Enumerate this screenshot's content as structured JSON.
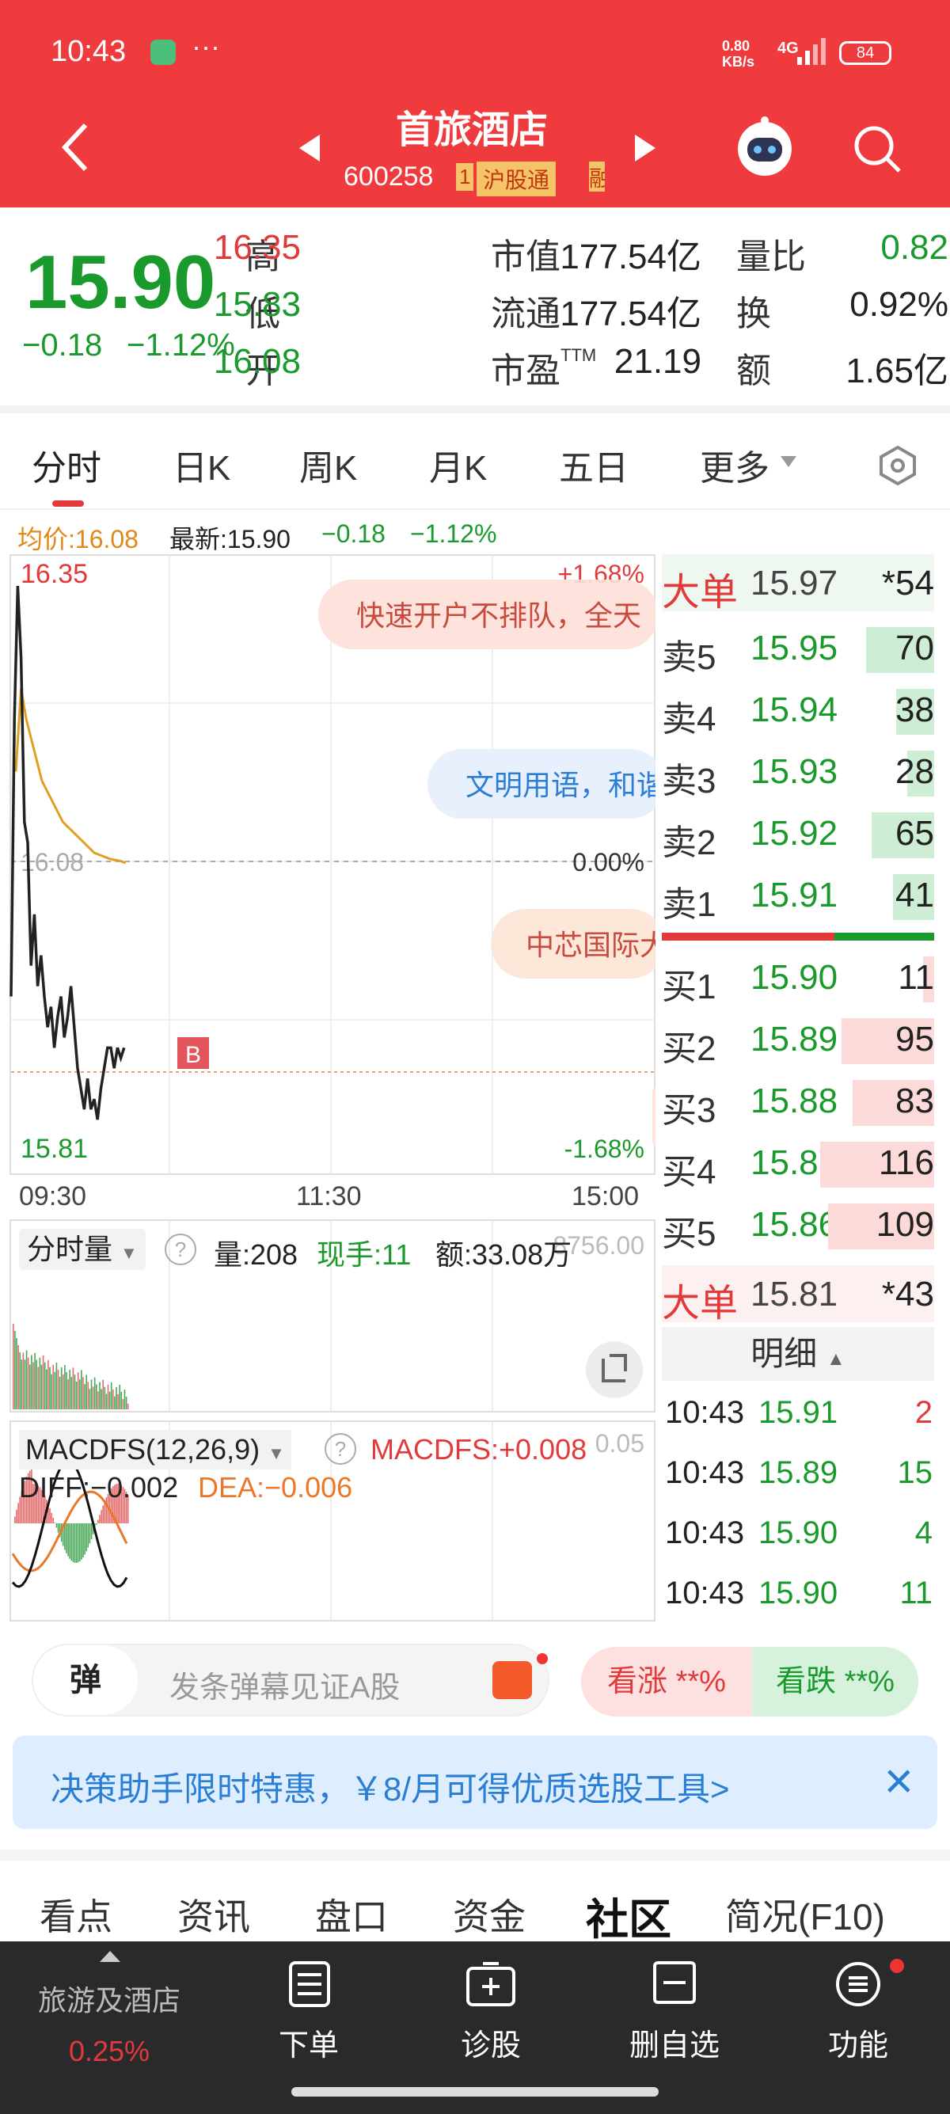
{
  "status_bar": {
    "time": "10:43",
    "dots": "···",
    "net": "0.80\nKB/s",
    "net_l1": "0.80",
    "net_l2": "KB/s",
    "signal": "4G",
    "battery": "84"
  },
  "header": {
    "title": "首旅酒店",
    "code": "600258",
    "tag1": "1",
    "tag2": "沪股通",
    "tag3": "融"
  },
  "quote": {
    "price": "15.90",
    "change": "−0.18",
    "pct": "−1.12%",
    "c1": [
      {
        "l": "高",
        "v": "16.35"
      },
      {
        "l": "低",
        "v": "15.83"
      },
      {
        "l": "开",
        "v": "16.08"
      }
    ],
    "c2": [
      {
        "l": "市值",
        "v": "177.54亿"
      },
      {
        "l": "流通",
        "v": "177.54亿"
      },
      {
        "l": "市盈",
        "sup": "TTM",
        "v": "21.19"
      }
    ],
    "c3": [
      {
        "l": "量比",
        "v": "0.82"
      },
      {
        "l": "换",
        "v": "0.92%"
      },
      {
        "l": "额",
        "v": "1.65亿"
      }
    ]
  },
  "tabs": [
    "分时",
    "日K",
    "周K",
    "月K",
    "五日",
    "更多"
  ],
  "info": {
    "avg": "均价:16.08",
    "latest": "最新:15.90",
    "chg": "−0.18",
    "pct": "−1.12%"
  },
  "chart_data": {
    "type": "line",
    "high": "16.35",
    "low": "15.81",
    "pre": "16.08",
    "pct_hi": "+1.68%",
    "pct_zero": "0.00%",
    "pct_lo": "-1.68%",
    "x_ticks": [
      "09:30",
      "11:30",
      "15:00"
    ],
    "price": [
      15.95,
      16.22,
      16.35,
      16.28,
      16.12,
      16.1,
      15.98,
      16.03,
      15.96,
      15.99,
      15.95,
      15.92,
      15.94,
      15.9,
      15.93,
      15.95,
      15.91,
      15.93,
      15.96,
      15.92,
      15.88,
      15.86,
      15.84,
      15.87,
      15.84,
      15.85,
      15.83,
      15.86,
      15.88,
      15.9,
      15.9,
      15.88,
      15.9,
      15.89,
      15.9
    ],
    "avg": [
      16.2,
      16.25,
      16.22,
      16.2,
      16.18,
      16.16,
      16.15,
      16.14,
      16.13,
      16.12,
      16.115,
      16.11,
      16.105,
      16.1,
      16.095,
      16.09,
      16.088,
      16.086,
      16.084,
      16.083,
      16.082,
      16.08
    ],
    "marker": "B"
  },
  "bubbles": [
    "快速开户不排队，全天",
    "文明用语，和谐",
    "中芯国际大"
  ],
  "orderbook": {
    "big_top": {
      "l": "大单",
      "p": "15.97",
      "v": "*54"
    },
    "sells": [
      {
        "l": "卖5",
        "p": "15.95",
        "v": "70",
        "w": 0.25
      },
      {
        "l": "卖4",
        "p": "15.94",
        "v": "38",
        "w": 0.14
      },
      {
        "l": "卖3",
        "p": "15.93",
        "v": "28",
        "w": 0.1
      },
      {
        "l": "卖2",
        "p": "15.92",
        "v": "65",
        "w": 0.23
      },
      {
        "l": "卖1",
        "p": "15.91",
        "v": "41",
        "w": 0.15
      }
    ],
    "buys": [
      {
        "l": "买1",
        "p": "15.90",
        "v": "11",
        "w": 0.04
      },
      {
        "l": "买2",
        "p": "15.89",
        "v": "95",
        "w": 0.34
      },
      {
        "l": "买3",
        "p": "15.88",
        "v": "83",
        "w": 0.3
      },
      {
        "l": "买4",
        "p": "15.87",
        "v": "116",
        "w": 0.42
      },
      {
        "l": "买5",
        "p": "15.86",
        "v": "109",
        "w": 0.39
      }
    ],
    "big_bot": {
      "l": "大单",
      "p": "15.81",
      "v": "*43"
    }
  },
  "detail": {
    "title": "明细",
    "rows": [
      {
        "t": "10:43",
        "p": "15.91",
        "v": "2",
        "c": "red"
      },
      {
        "t": "10:43",
        "p": "15.89",
        "v": "15",
        "c": "green"
      },
      {
        "t": "10:43",
        "p": "15.90",
        "v": "4",
        "c": "green"
      },
      {
        "t": "10:43",
        "p": "15.90",
        "v": "11",
        "c": "green"
      }
    ]
  },
  "volume": {
    "label": "分时量",
    "q": "?",
    "vol": "量:208",
    "hand": "现手:11",
    "amt": "额:33.08万",
    "right": "8756.00"
  },
  "macd": {
    "label": "MACDFS(12,26,9)",
    "q": "?",
    "val": "MACDFS:+0.008",
    "diff": "DIFF:−0.002",
    "dea": "DEA:−0.006",
    "right": "0.05"
  },
  "danmu": {
    "icon": "弹",
    "placeholder": "发条弹幕见证A股",
    "up": "看涨 **%",
    "down": "看跌 **%"
  },
  "promo": {
    "text": "决策助手限时特惠，￥8/月可得优质选股工具>",
    "close": "×"
  },
  "bottom_tabs": [
    "看点",
    "资讯",
    "盘口",
    "资金",
    "社区",
    "简况(F10)"
  ],
  "nav": {
    "sector": "旅游及酒店",
    "sector_pct": "0.25%",
    "items": [
      "下单",
      "诊股",
      "删自选",
      "功能"
    ]
  }
}
